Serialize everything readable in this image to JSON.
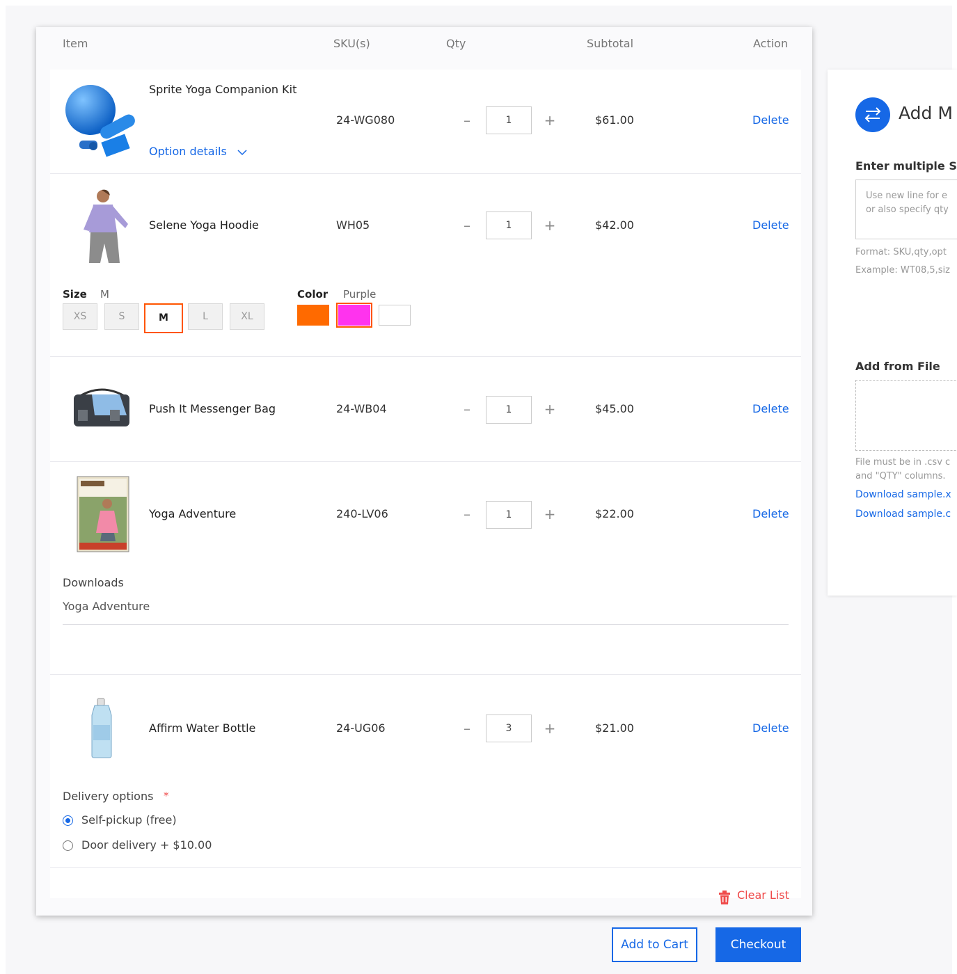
{
  "table": {
    "headers": {
      "item": "Item",
      "sku": "SKU(s)",
      "qty": "Qty",
      "subtotal": "Subtotal",
      "action": "Action"
    }
  },
  "items": [
    {
      "name": "Sprite Yoga Companion Kit",
      "sku": "24-WG080",
      "qty": "1",
      "subtotal": "$61.00",
      "action": "Delete",
      "option_details": "Option details"
    },
    {
      "name": "Selene Yoga Hoodie",
      "sku": "WH05",
      "qty": "1",
      "subtotal": "$42.00",
      "action": "Delete",
      "size_label": "Size",
      "size_value": "M",
      "sizes": [
        "XS",
        "S",
        "M",
        "L",
        "XL"
      ],
      "selected_size": "M",
      "color_label": "Color",
      "color_value": "Purple",
      "swatches": [
        "#ff6a00",
        "#ff33ee",
        "#ffffff"
      ],
      "selected_swatch": 1
    },
    {
      "name": "Push It Messenger Bag",
      "sku": "24-WB04",
      "qty": "1",
      "subtotal": "$45.00",
      "action": "Delete"
    },
    {
      "name": "Yoga Adventure",
      "sku": "240-LV06",
      "qty": "1",
      "subtotal": "$22.00",
      "action": "Delete",
      "downloads_label": "Downloads",
      "downloads_value": "Yoga Adventure"
    },
    {
      "name": "Affirm Water Bottle",
      "sku": "24-UG06",
      "qty": "3",
      "subtotal": "$21.00",
      "action": "Delete",
      "delivery_label": "Delivery options",
      "required_mark": "*",
      "delivery_options": [
        {
          "label": "Self-pickup (free)",
          "checked": true
        },
        {
          "label": "Door delivery + $10.00",
          "checked": false
        }
      ]
    }
  ],
  "qty_controls": {
    "minus": "–",
    "plus": "+"
  },
  "clear_list": "Clear List",
  "buttons": {
    "add_to_cart": "Add to Cart",
    "checkout": "Checkout"
  },
  "sidebar": {
    "title": "Add M",
    "enter_label": "Enter multiple S",
    "textarea_line1": "Use new line for e",
    "textarea_line2": "or also specify qty",
    "format_note": "Format: SKU,qty,opt",
    "example_note": "Example: WT08,5,siz",
    "file_label": "Add from File",
    "file_note1": "File must be in .csv c",
    "file_note2": "and \"QTY\" columns.",
    "download1": "Download sample.x",
    "download2": "Download sample.c"
  },
  "colors": {
    "accent": "#1668e6",
    "selection": "#ff5500",
    "danger": "#ef4b4b"
  }
}
